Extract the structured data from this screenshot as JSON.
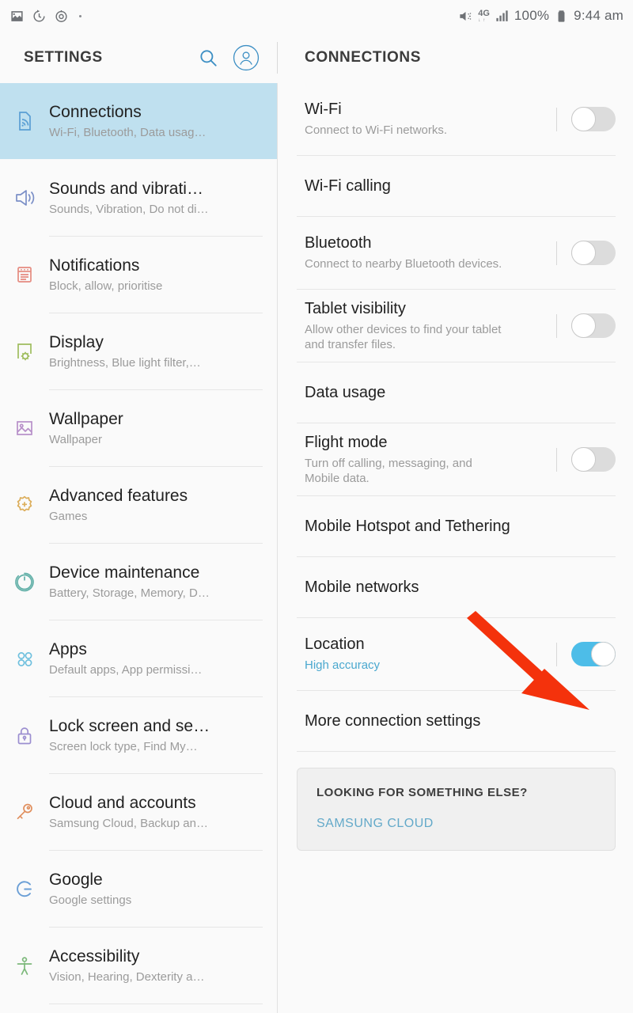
{
  "statusbar": {
    "left_icons": [
      "image-icon",
      "timer-icon",
      "alarm-icon"
    ],
    "network": "4G",
    "network_sub": "↓↑",
    "battery_percent": "100%",
    "time": "9:44 am",
    "right_icons": [
      "mute-icon",
      "signal-icon",
      "battery-icon"
    ]
  },
  "header": {
    "settings_title": "SETTINGS",
    "page_title": "CONNECTIONS",
    "search_icon": "search-icon",
    "account_icon": "account-icon"
  },
  "colors": {
    "accent": "#4dbde8",
    "selected_row": "#bfe0ef",
    "link": "#63a9c9",
    "arrow": "#f4320c",
    "sub_text": "#9b9b9b"
  },
  "sidebar": {
    "items": [
      {
        "title": "Connections",
        "subtitle": "Wi-Fi, Bluetooth, Data usag…",
        "icon": "connections-icon",
        "selected": true
      },
      {
        "title": "Sounds and vibrati…",
        "subtitle": "Sounds, Vibration, Do not di…",
        "icon": "sound-icon",
        "selected": false
      },
      {
        "title": "Notifications",
        "subtitle": "Block, allow, prioritise",
        "icon": "notifications-icon",
        "selected": false
      },
      {
        "title": "Display",
        "subtitle": "Brightness, Blue light filter,…",
        "icon": "display-icon",
        "selected": false
      },
      {
        "title": "Wallpaper",
        "subtitle": "Wallpaper",
        "icon": "wallpaper-icon",
        "selected": false
      },
      {
        "title": "Advanced features",
        "subtitle": "Games",
        "icon": "advanced-features-icon",
        "selected": false
      },
      {
        "title": "Device maintenance",
        "subtitle": "Battery, Storage, Memory, D…",
        "icon": "device-maintenance-icon",
        "selected": false
      },
      {
        "title": "Apps",
        "subtitle": "Default apps, App permissi…",
        "icon": "apps-icon",
        "selected": false
      },
      {
        "title": "Lock screen and se…",
        "subtitle": "Screen lock type, Find My…",
        "icon": "lock-icon",
        "selected": false
      },
      {
        "title": "Cloud and accounts",
        "subtitle": "Samsung Cloud, Backup an…",
        "icon": "key-icon",
        "selected": false
      },
      {
        "title": "Google",
        "subtitle": "Google settings",
        "icon": "google-icon",
        "selected": false
      },
      {
        "title": "Accessibility",
        "subtitle": "Vision, Hearing, Dexterity a…",
        "icon": "accessibility-icon",
        "selected": false
      }
    ]
  },
  "connections": {
    "rows": [
      {
        "title": "Wi-Fi",
        "subtitle": "Connect to Wi-Fi networks.",
        "has_toggle": true,
        "toggle_on": false
      },
      {
        "title": "Wi-Fi calling",
        "subtitle": "",
        "has_toggle": false,
        "toggle_on": false
      },
      {
        "title": "Bluetooth",
        "subtitle": "Connect to nearby Bluetooth devices.",
        "has_toggle": true,
        "toggle_on": false
      },
      {
        "title": "Tablet visibility",
        "subtitle": "Allow other devices to find your tablet and transfer files.",
        "has_toggle": true,
        "toggle_on": false
      },
      {
        "title": "Data usage",
        "subtitle": "",
        "has_toggle": false,
        "toggle_on": false
      },
      {
        "title": "Flight mode",
        "subtitle": "Turn off calling, messaging, and Mobile data.",
        "has_toggle": true,
        "toggle_on": false
      },
      {
        "title": "Mobile Hotspot and Tethering",
        "subtitle": "",
        "has_toggle": false,
        "toggle_on": false
      },
      {
        "title": "Mobile networks",
        "subtitle": "",
        "has_toggle": false,
        "toggle_on": false
      },
      {
        "title": "Location",
        "subtitle": "High accuracy",
        "subtitle_accent": true,
        "has_toggle": true,
        "toggle_on": true
      },
      {
        "title": "More connection settings",
        "subtitle": "",
        "has_toggle": false,
        "toggle_on": false
      }
    ],
    "promo_card": {
      "title": "LOOKING FOR SOMETHING ELSE?",
      "link": "SAMSUNG CLOUD"
    }
  },
  "annotation": {
    "arrow": "red-arrow-pointing-to-location-toggle"
  }
}
